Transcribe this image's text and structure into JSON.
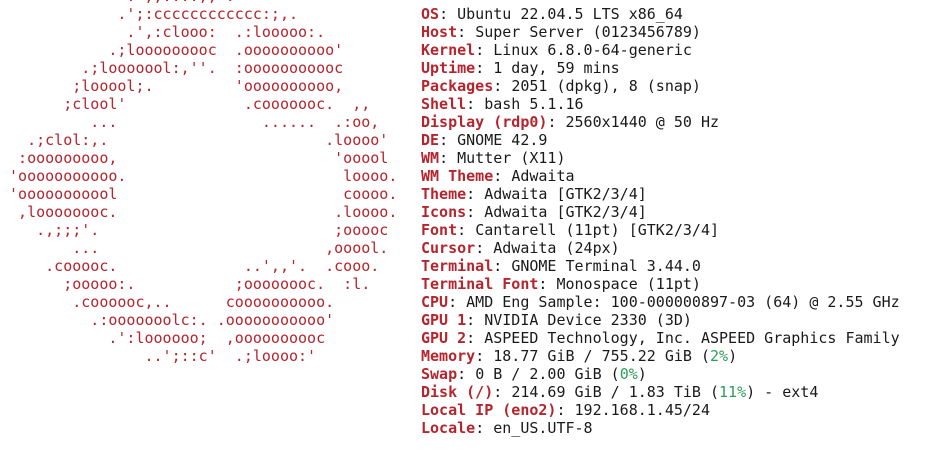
{
  "theme": {
    "accent": "#b5252e",
    "text": "#1a1a1a",
    "percent": "#2e9e5b",
    "background": "#ffffff"
  },
  "logo_lines": [
    "              .',;::::;,'.",
    "             .';:cccccccccccc:;,.",
    "              .',:clooo:  .:looooo:.",
    "            .;looooooooc  .oooooooooo'",
    "         .;looooool:,''.  :ooooooooooc",
    "        ;looool;.         'oooooooooo,",
    "       ;clool'             .cooooooc.  ,,",
    "          ...                ......  .:oo,",
    "   .;clol:,.                        .loooo'",
    "  :ooooooooo,                        'ooool",
    " 'ooooooooooo.                        loooo.",
    " 'ooooooooool                         coooo.",
    "  ,loooooooc.                        .loooo.",
    "    .,;;;'.                          ;ooooc",
    "        ...                         ,ooool.",
    "     .cooooc.              ..',,'.  .cooo.",
    "       ;ooooo:.           ;oooooooc.  :l.",
    "        .coooooc,..      coooooooooo.",
    "          .:ooooooolc:. .ooooooooooo'",
    "            .':loooooo;  ,oooooooooc",
    "                ..';::c'  .;loooo:'"
  ],
  "separator": "------------",
  "info": [
    {
      "key": "OS",
      "value": "Ubuntu 22.04.5 LTS x86_64"
    },
    {
      "key": "Host",
      "value": "Super Server (0123456789)"
    },
    {
      "key": "Kernel",
      "value": "Linux 6.8.0-64-generic"
    },
    {
      "key": "Uptime",
      "value": "1 day, 59 mins"
    },
    {
      "key": "Packages",
      "value": "2051 (dpkg), 8 (snap)"
    },
    {
      "key": "Shell",
      "value": "bash 5.1.16"
    },
    {
      "key": "Display (rdp0)",
      "value": "2560x1440 @ 50 Hz"
    },
    {
      "key": "DE",
      "value": "GNOME 42.9"
    },
    {
      "key": "WM",
      "value": "Mutter (X11)"
    },
    {
      "key": "WM Theme",
      "value": "Adwaita"
    },
    {
      "key": "Theme",
      "value": "Adwaita [GTK2/3/4]"
    },
    {
      "key": "Icons",
      "value": "Adwaita [GTK2/3/4]"
    },
    {
      "key": "Font",
      "value": "Cantarell (11pt) [GTK2/3/4]"
    },
    {
      "key": "Cursor",
      "value": "Adwaita (24px)"
    },
    {
      "key": "Terminal",
      "value": "GNOME Terminal 3.44.0"
    },
    {
      "key": "Terminal Font",
      "value": "Monospace (11pt)"
    },
    {
      "key": "CPU",
      "value": "AMD Eng Sample: 100-000000897-03 (64) @ 2.55 GHz"
    },
    {
      "key": "GPU 1",
      "value": "NVIDIA Device 2330 (3D)"
    },
    {
      "key": "GPU 2",
      "value": "ASPEED Technology, Inc. ASPEED Graphics Family"
    },
    {
      "key": "Memory",
      "value": "18.77 GiB / 755.22 GiB (",
      "pct": "2%",
      "after": ")"
    },
    {
      "key": "Swap",
      "value": "0 B / 2.00 GiB (",
      "pct": "0%",
      "after": ")"
    },
    {
      "key": "Disk (/)",
      "value": "214.69 GiB / 1.83 TiB (",
      "pct": "11%",
      "after": ") - ext4"
    },
    {
      "key": "Local IP (eno2)",
      "value": "192.168.1.45/24"
    },
    {
      "key": "Locale",
      "value": "en_US.UTF-8"
    }
  ]
}
